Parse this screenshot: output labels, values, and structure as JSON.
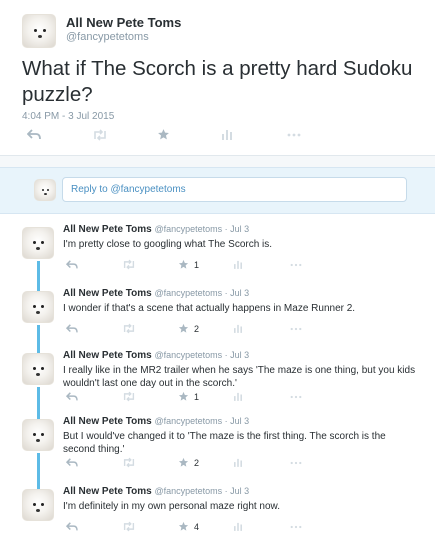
{
  "main_tweet": {
    "name": "All New Pete Toms",
    "handle": "@fancypetetoms",
    "text": "What if The Scorch is a pretty hard Sudoku puzzle?",
    "timestamp": "4:04 PM - 3 Jul 2015"
  },
  "reply_box": {
    "placeholder": "Reply to @fancypetetoms"
  },
  "replies": [
    {
      "name": "All New Pete Toms",
      "meta": "@fancypetetoms · Jul 3",
      "text": "I'm pretty close to googling what The Scorch is.",
      "favorites": "1"
    },
    {
      "name": "All New Pete Toms",
      "meta": "@fancypetetoms · Jul 3",
      "text": "I wonder if that's a scene that actually happens in Maze Runner 2.",
      "favorites": "2"
    },
    {
      "name": "All New Pete Toms",
      "meta": "@fancypetetoms · Jul 3",
      "text": "I really like in the MR2 trailer when he says 'The maze is one thing, but you kids wouldn't last one day out in the scorch.'",
      "favorites": "1"
    },
    {
      "name": "All New Pete Toms",
      "meta": "@fancypetetoms · Jul 3",
      "text": "But I would've changed it to 'The maze is the first thing. The scorch is the second thing.'",
      "favorites": "2"
    },
    {
      "name": "All New Pete Toms",
      "meta": "@fancypetetoms · Jul 3",
      "text": "I'm definitely in my own personal maze right now.",
      "favorites": "4"
    }
  ],
  "icons": [
    "reply-icon",
    "retweet-icon",
    "favorite-icon",
    "stats-icon",
    "more-icon"
  ],
  "colors": {
    "accent": "#5dbbe6",
    "muted": "#aab8c2",
    "reply_bg": "#e8f4fb"
  }
}
